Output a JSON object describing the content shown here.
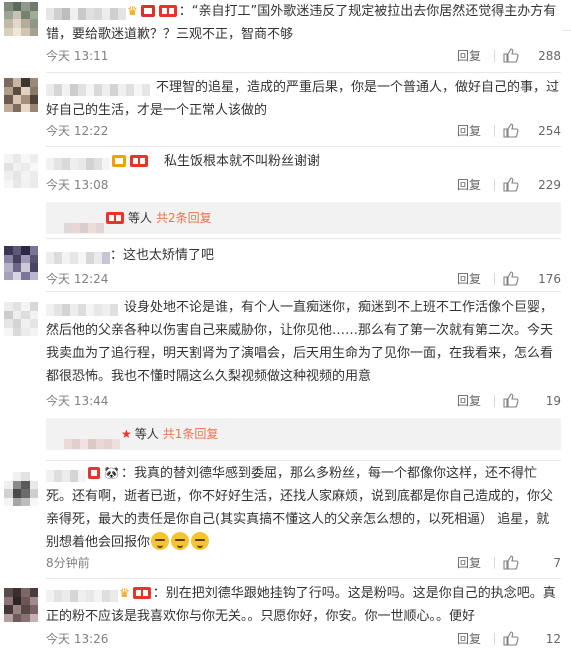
{
  "comments": [
    {
      "text_prefix": "：“",
      "text": "亲自打工”国外歌迷违反了规定被拉出去你居然还觉得主办方有错，要给歌迷道歉？？三观不正，智商不够",
      "time": "今天 13:11",
      "reply": "回复",
      "likes": "288"
    },
    {
      "text": "不理智的追星，造成的严重后果，你是一个普通人，做好自己的事，过好自己的生活，才是一个正常人该做的",
      "time": "今天 12:22",
      "reply": "回复",
      "likes": "254"
    },
    {
      "text": "私生饭根本就不叫粉丝谢谢",
      "time": "今天 13:08",
      "reply": "回复",
      "likes": "229",
      "subreply": {
        "label": "等人",
        "more": "共2条回复"
      }
    },
    {
      "text": "：这也太矫情了吧",
      "time": "今天 12:24",
      "reply": "回复",
      "likes": "176"
    },
    {
      "text": "设身处地不论是谁，有个人一直痴迷你，痴迷到不上班不工作活像个巨婴，然后他的父亲各种以伤害自己来威胁你，让你见他……那么有了第一次就有第二次。今天我卖血为了追行程，明天割肾为了演唱会，后天用生命为了见你一面，在我看来，怎么看都很恐怖。我也不懂时隔这么久梨视频做这种视频的用意",
      "time": "今天 13:44",
      "reply": "回复",
      "likes": "19",
      "subreply": {
        "label": "等人",
        "more": "共1条回复"
      }
    },
    {
      "text": "：我真的替刘德华感到委屈，那么多粉丝，每一个都像你这样，还不得忙死。还有啊，逝者已逝，你不好好生活，还找人家麻烦，说到底都是你自己造成的，你父亲得死，最大的责任是你自己(其实真搞不懂这人的父亲怎么想的，以死相逼）  追星，就别想着他会回报你",
      "time": "8分钟前",
      "reply": "回复",
      "likes": "7"
    },
    {
      "text": "：别在把刘德华跟她挂钩了行吗。这是粉吗。这是你自己的执念吧。真正的粉不应该是我喜欢你与你无关。。只愿你好，你安。你一世顺心。。便好",
      "time": "今天 13:26",
      "reply": "回复",
      "likes": "12"
    }
  ],
  "colors": {
    "accent_link": "#eb7350",
    "badge_red": "#e8342a",
    "meta_gray": "#808080",
    "subreply_bg": "#f2f2f2"
  },
  "icons": {
    "like": "thumbs-up-icon",
    "member": "vip-badge-icon",
    "emoji": "speechless-face-emoji"
  }
}
